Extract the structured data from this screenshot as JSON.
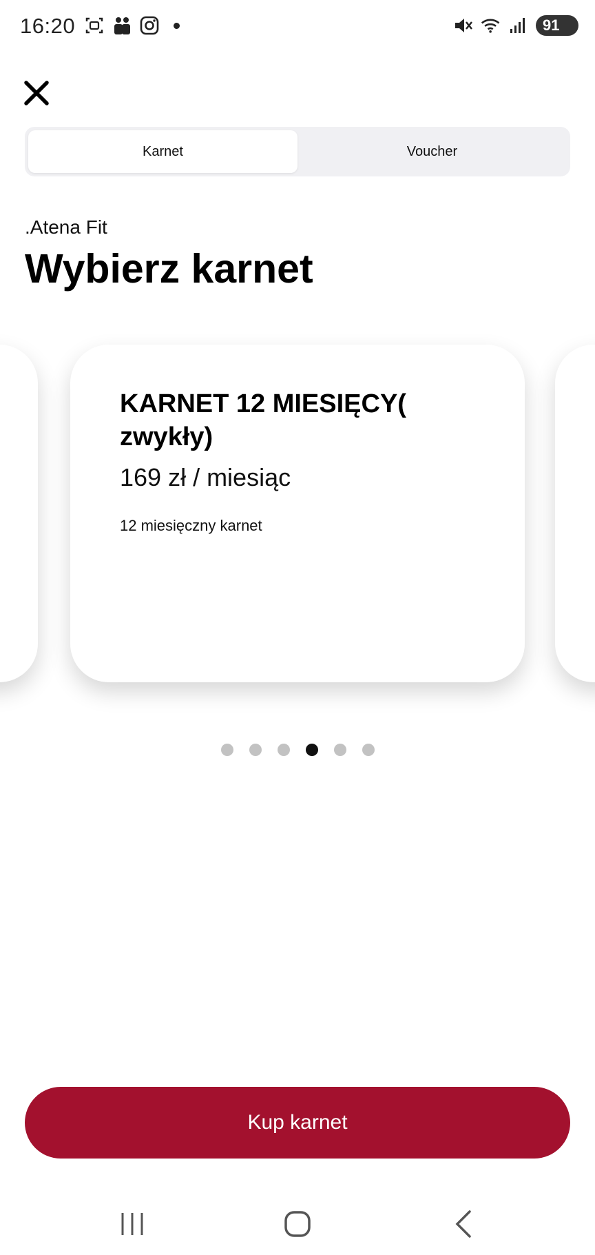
{
  "status_bar": {
    "time": "16:20",
    "battery": "91",
    "left_icons": [
      "screen-capture-icon",
      "people-icon",
      "instagram-icon",
      "notification-dot-icon"
    ],
    "right_icons": [
      "mute-icon",
      "wifi-icon",
      "signal-icon",
      "battery-icon"
    ]
  },
  "tabs": {
    "items": [
      {
        "label": "Karnet",
        "active": true
      },
      {
        "label": "Voucher",
        "active": false
      }
    ]
  },
  "header": {
    "gym_name": ".Atena Fit",
    "title": "Wybierz karnet"
  },
  "carousel": {
    "current_card": {
      "title": "KARNET 12 MIESIĘCY( zwykły)",
      "price": "169 zł / miesiąc",
      "description": "12 miesięczny karnet"
    },
    "page_count": 6,
    "active_page": 4
  },
  "actions": {
    "buy_label": "Kup karnet"
  },
  "colors": {
    "primary": "#a3112e",
    "segment_bg": "#f0f0f3",
    "dot_inactive": "#c2c2c2",
    "dot_active": "#111111"
  }
}
